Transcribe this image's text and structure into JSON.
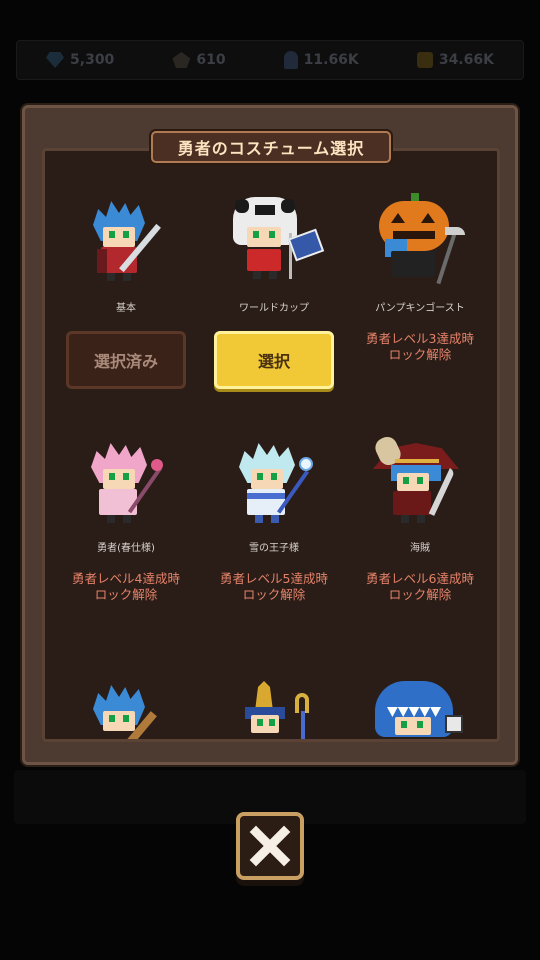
{
  "resources": [
    {
      "icon": "gem-icon",
      "value": "5,300"
    },
    {
      "icon": "ore-icon",
      "value": "610"
    },
    {
      "icon": "hero-count-icon",
      "value": "11.66K"
    },
    {
      "icon": "coin-icon",
      "value": "34.66K"
    }
  ],
  "dialog": {
    "title": "勇者のコスチューム選択",
    "costumes": [
      {
        "name": "基本",
        "button": "選択済み",
        "state": "selected"
      },
      {
        "name": "ワールドカップ",
        "button": "選択",
        "state": "available"
      },
      {
        "name": "パンプキンゴースト",
        "lock_line1": "勇者レベル3達成時",
        "lock_line2": "ロック解除",
        "state": "locked"
      },
      {
        "name": "勇者(春仕様)",
        "lock_line1": "勇者レベル4達成時",
        "lock_line2": "ロック解除",
        "state": "locked"
      },
      {
        "name": "雪の王子様",
        "lock_line1": "勇者レベル5達成時",
        "lock_line2": "ロック解除",
        "state": "locked"
      },
      {
        "name": "海賊",
        "lock_line1": "勇者レベル6達成時",
        "lock_line2": "ロック解除",
        "state": "locked"
      }
    ]
  },
  "close_button": {
    "icon": "close-icon"
  },
  "colors": {
    "panel": "#4d3a30",
    "inner": "#2a1d17",
    "select_button": "#f1c936",
    "lock_text": "#e4826a"
  }
}
